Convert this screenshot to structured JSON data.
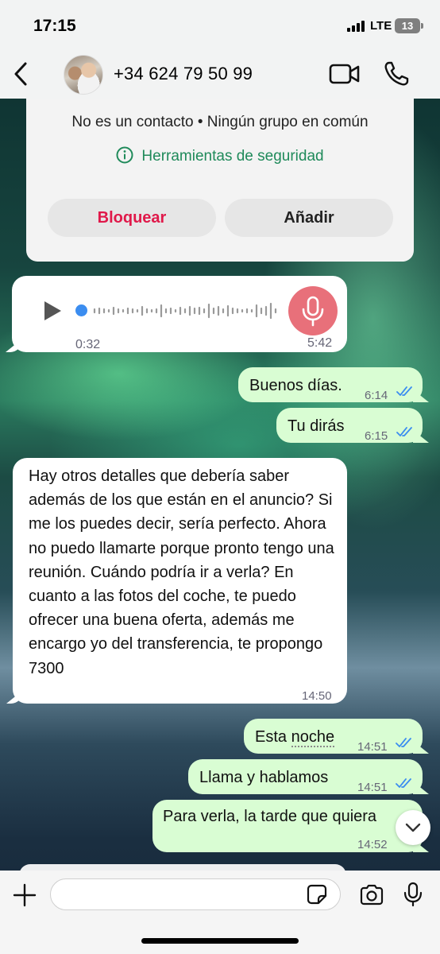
{
  "status_bar": {
    "time": "17:15",
    "network": "LTE",
    "battery": "13"
  },
  "header": {
    "contact_name": "+34 624 79 50 99",
    "icons": [
      "back-icon",
      "avatar",
      "video-call-icon",
      "phone-icon"
    ]
  },
  "info_card": {
    "info_text": "No es un contacto • Ningún grupo en común",
    "safety_label": "Herramientas de seguridad",
    "block_label": "Bloquear",
    "add_label": "Añadir"
  },
  "voice_message": {
    "duration": "0:32",
    "time": "5:42"
  },
  "messages": [
    {
      "direction": "out",
      "text": "Buenos días.",
      "time": "6:14"
    },
    {
      "direction": "out",
      "text": "Tu dirás",
      "time": "6:15"
    },
    {
      "direction": "in",
      "text": "Hay otros detalles que debería saber además de los que están en el anuncio? Si me los puedes decir, sería perfecto. Ahora no puedo llamarte porque pronto tengo una reunión. Cuándo podría ir a verla? En cuanto a las fotos del coche, te puedo ofrecer una buena oferta, además me encargo yo del transferencia, te propongo 7300",
      "time": "14:50"
    },
    {
      "direction": "out",
      "text_prefix": "Esta ",
      "text_link": "noche",
      "time": "14:51"
    },
    {
      "direction": "out",
      "text": "Llama y hablamos",
      "time": "14:51"
    },
    {
      "direction": "out",
      "text": "Para verla, la tarde que quiera",
      "time": "14:52"
    }
  ],
  "composer": {
    "placeholder": "",
    "value": ""
  },
  "colors": {
    "accent_green": "#1f8a5a",
    "danger_red": "#e0194a",
    "outgoing_bubble": "#d9fdd3",
    "read_ticks": "#3b8df0"
  }
}
